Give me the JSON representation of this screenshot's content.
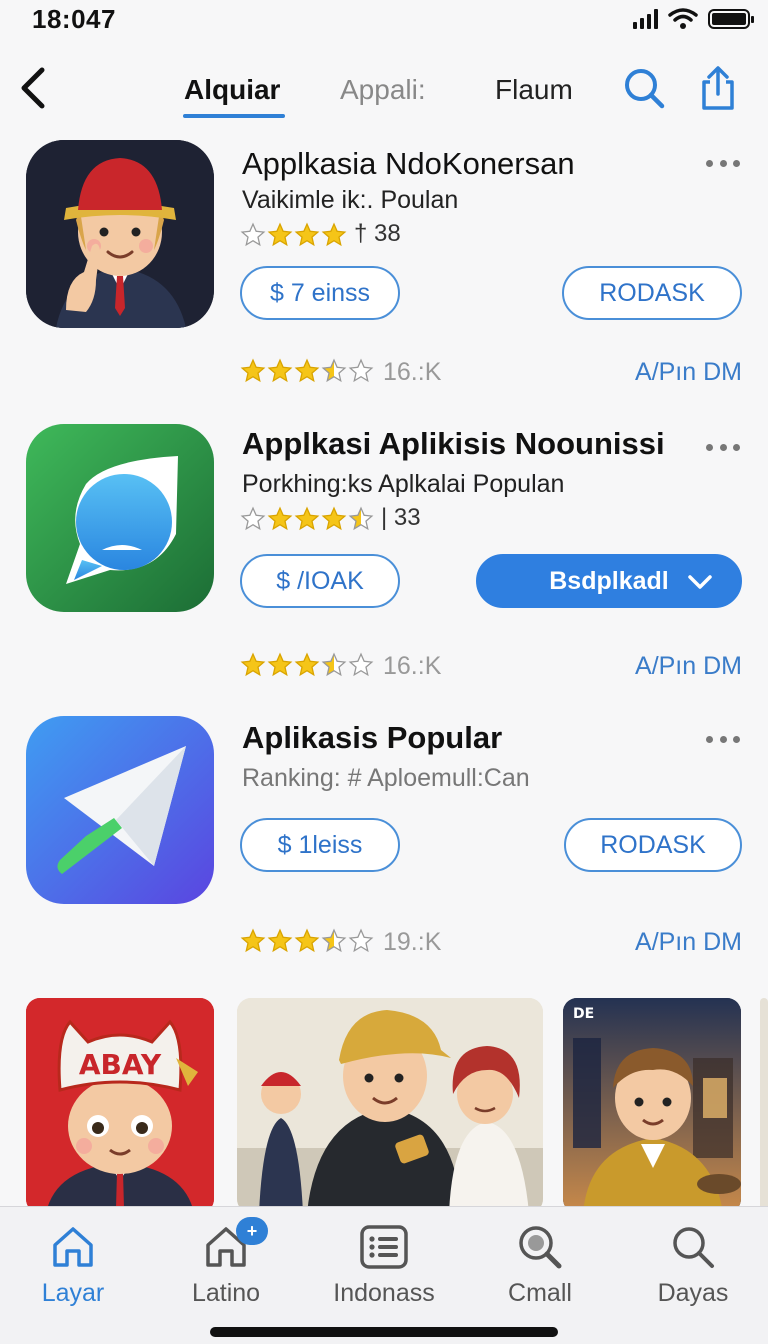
{
  "status": {
    "time": "18:047"
  },
  "nav": {
    "tabs": [
      {
        "label": "Alquiar",
        "active": true
      },
      {
        "label": "Appali:",
        "active": false
      },
      {
        "label": "Flaum",
        "active": false
      }
    ]
  },
  "apps": [
    {
      "title": "Applkasia NdoKonersan",
      "subtitle": "Vaikimle ik:. Poulan",
      "rating_text": "† 38",
      "rating_value": 3,
      "price_label": "$ 7 einss",
      "action_label": "RODASK",
      "meta_rating": 3.5,
      "meta_count": "16.:K",
      "meta_link": "A/Pın DM"
    },
    {
      "title": "Applkasi Aplikisis Noounissi",
      "subtitle": "Porkhing:ks Aplkalai Populan",
      "rating_text": "| 33",
      "rating_value": 3.5,
      "price_label": "$ /IOAK",
      "action_label": "Bsdplkadl",
      "meta_rating": 3.5,
      "meta_count": "16.:K",
      "meta_link": "A/Pın DM"
    },
    {
      "title": "Aplikasis Popular",
      "subtitle": "Ranking: # Aploemull:Can",
      "price_label": "$ 1leiss",
      "action_label": "RODASK",
      "meta_rating": 3.5,
      "meta_count": "19.:K",
      "meta_link": "A/Pın DM"
    }
  ],
  "gallery": {
    "cards": [
      {
        "hat_text": "ABAY",
        "name": "gallery-card-1"
      },
      {
        "name": "gallery-card-2"
      },
      {
        "badge": "DE",
        "name": "gallery-card-3"
      }
    ]
  },
  "tabbar": {
    "items": [
      {
        "label": "Layar",
        "icon": "home-icon",
        "active": true
      },
      {
        "label": "Latino",
        "icon": "home-badge-icon",
        "badge": "+"
      },
      {
        "label": "Indonass",
        "icon": "list-icon"
      },
      {
        "label": "Cmall",
        "icon": "magnifier-icon"
      },
      {
        "label": "Dayas",
        "icon": "search-icon"
      }
    ]
  },
  "colors": {
    "accent": "#2f80d6",
    "star": "#f5c518"
  }
}
